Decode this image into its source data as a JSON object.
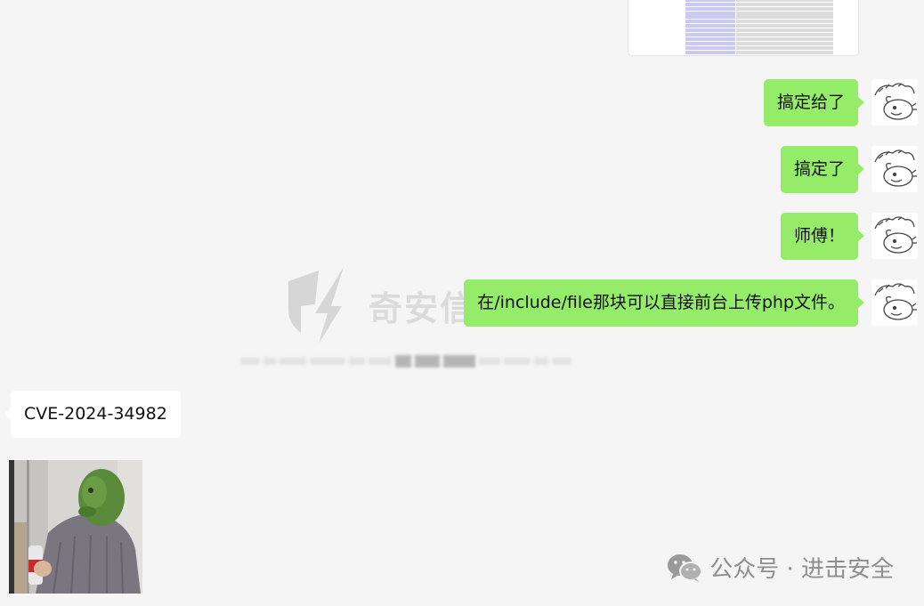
{
  "messages": {
    "m1": "搞定给了",
    "m2": "搞定了",
    "m3": "师傅！",
    "m4": "在/include/file那块可以直接前台上传php文件。",
    "cve": "CVE-2024-34982"
  },
  "watermark": {
    "text": "奇安信攻防社区"
  },
  "brand": {
    "label": "公众号 · 进击安全"
  },
  "icons": {
    "avatar": "sketch-cat-avatar-icon",
    "wechat": "wechat-icon",
    "watermark_logo": "lightning-shield-icon"
  },
  "colors": {
    "bubble_self": "#95ec69",
    "bubble_other": "#ffffff",
    "background": "#f5f5f5"
  }
}
